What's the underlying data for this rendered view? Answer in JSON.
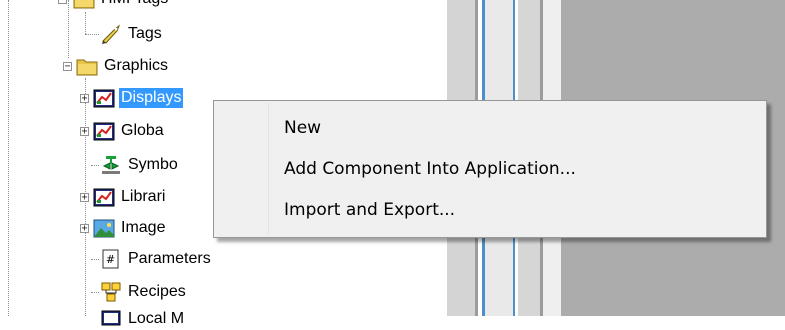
{
  "tree": {
    "top_item_label": "HMI Tags",
    "items": [
      {
        "label": "Tags"
      },
      {
        "label": "Graphics"
      },
      {
        "label": "Displays"
      },
      {
        "label": "Globa"
      },
      {
        "label": "Symbo"
      },
      {
        "label": "Librari"
      },
      {
        "label": "Image"
      },
      {
        "label": "Parameters"
      },
      {
        "label": "Recipes"
      },
      {
        "label": "Local M"
      }
    ],
    "expander_symbol_collapsed": "+",
    "expander_symbol_expanded": "−"
  },
  "context_menu": {
    "items": [
      {
        "label": "New"
      },
      {
        "label": "Add Component Into Application..."
      },
      {
        "label": "Import and Export..."
      }
    ]
  },
  "colors": {
    "selection": "#3399ff",
    "menu_background": "#f0f0f0",
    "workspace_gray": "#acacac",
    "splitter_blue": "#4f8fc9"
  }
}
